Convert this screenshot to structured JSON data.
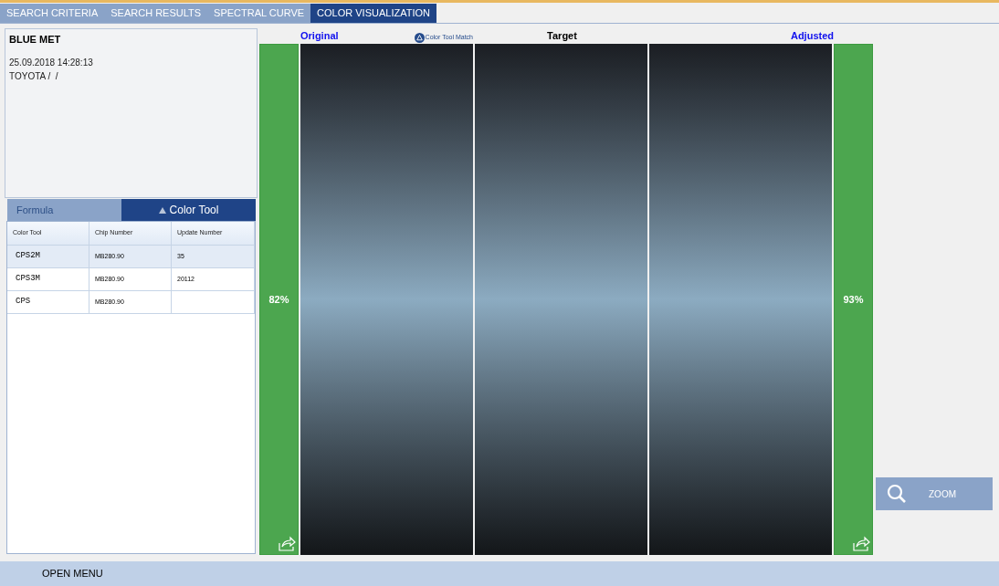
{
  "tabs": [
    {
      "label": "SEARCH CRITERIA",
      "selected": false
    },
    {
      "label": "SEARCH RESULTS",
      "selected": false
    },
    {
      "label": "SPECTRAL CURVE",
      "selected": false
    },
    {
      "label": "COLOR VISUALIZATION",
      "selected": true
    }
  ],
  "info": {
    "title": "BLUE MET",
    "date": "25.09.2018 14:28:13",
    "make": "TOYOTA /  /"
  },
  "panel_tabs": [
    {
      "label": "Formula",
      "selected": false,
      "icon": false
    },
    {
      "label": "Color Tool",
      "selected": true,
      "icon": true
    }
  ],
  "table": {
    "columns": [
      "Color Tool",
      "Chip Number",
      "Update Number"
    ],
    "rows": [
      {
        "cells": [
          "CPS2M",
          "MB280.90",
          "35"
        ],
        "selected": true
      },
      {
        "cells": [
          "CPS3M",
          "MB280.90",
          "20112"
        ],
        "selected": false
      },
      {
        "cells": [
          "CPS",
          "MB280.90",
          ""
        ],
        "selected": false
      }
    ]
  },
  "visualization": {
    "labels": {
      "original": "Original",
      "match": "Color Tool Match",
      "target": "Target",
      "adjusted": "Adjusted"
    },
    "left_score": "82%",
    "right_score": "93%"
  },
  "zoom_button": "ZOOM",
  "bottom_bar": {
    "menu": "OPEN MENU"
  }
}
